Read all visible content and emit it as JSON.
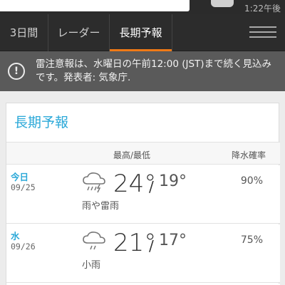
{
  "status": {
    "time": "1:22午後"
  },
  "tabs": [
    {
      "label": "3日間"
    },
    {
      "label": "レーダー"
    },
    {
      "label": "長期予報"
    }
  ],
  "alert": {
    "text": "雷注意報は、水曜日の午前12:00 (JST)まで続く見込みです。発表者: 気象庁."
  },
  "card": {
    "title": "長期予報",
    "header": {
      "hilo": "最高/最低",
      "pop": "降水確率"
    },
    "rows": [
      {
        "day": "今日",
        "date": "09/25",
        "icon": "thunder-rain-icon",
        "condition": "雨や雷雨",
        "high": "24°",
        "low": "19°",
        "pop": "90%"
      },
      {
        "day": "水",
        "date": "09/26",
        "icon": "light-rain-icon",
        "condition": "小雨",
        "high": "21°",
        "low": "17°",
        "pop": "75%"
      }
    ]
  },
  "colors": {
    "accent_tab": "#f07a16",
    "accent_text": "#2aa8d8"
  }
}
